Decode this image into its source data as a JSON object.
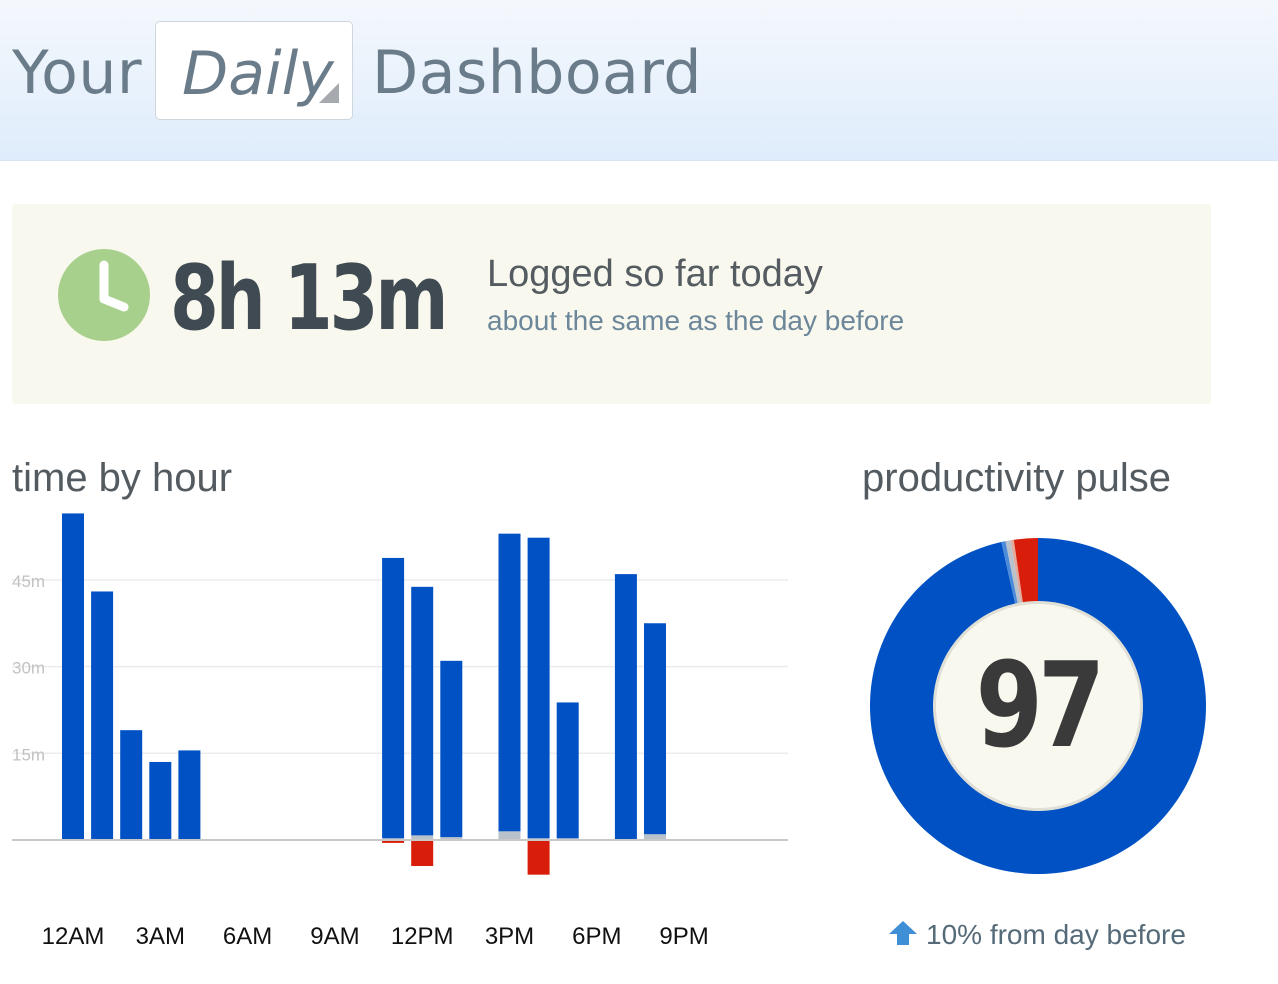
{
  "header": {
    "prefix": "Your",
    "period_selected": "Daily",
    "suffix": "Dashboard"
  },
  "summary": {
    "total_time": "8h 13m",
    "headline": "Logged so far today",
    "comparison": "about the same as the day before",
    "clock_color": "#a8d08d"
  },
  "time_by_hour": {
    "title": "time by hour",
    "chart_data": {
      "type": "bar",
      "title": "time by hour",
      "unit": "minutes",
      "y_ticks": [
        {
          "value": 15,
          "label": "15m"
        },
        {
          "value": 30,
          "label": "30m"
        },
        {
          "value": 45,
          "label": "45m"
        }
      ],
      "ylim": [
        -6,
        57
      ],
      "x_tick_labels": [
        "12AM",
        "3AM",
        "6AM",
        "9AM",
        "12PM",
        "3PM",
        "6PM",
        "9PM"
      ],
      "x_tick_hours": [
        0,
        3,
        6,
        9,
        12,
        15,
        18,
        21
      ],
      "hours": [
        0,
        1,
        2,
        3,
        4,
        5,
        6,
        7,
        8,
        9,
        10,
        11,
        12,
        13,
        14,
        15,
        16,
        17,
        18,
        19,
        20,
        21,
        22,
        23
      ],
      "series": [
        {
          "key": "productive",
          "color": "#0052c4",
          "values": [
            56.5,
            43,
            19,
            13.5,
            15.5,
            0,
            0,
            0,
            0,
            0,
            0,
            48.5,
            43,
            30.5,
            0,
            51.5,
            52,
            23.5,
            0,
            46,
            36.5,
            0,
            0,
            0
          ]
        },
        {
          "key": "neutral",
          "color": "#b9c2cb",
          "values": [
            0,
            0,
            0,
            0,
            0,
            0,
            0,
            0,
            0,
            0,
            0,
            0.3,
            0.8,
            0.5,
            0,
            1.5,
            0.3,
            0.3,
            0,
            0,
            1,
            0,
            0,
            0
          ]
        },
        {
          "key": "distracting",
          "color": "#d81d0a",
          "values": [
            0,
            0,
            0,
            0,
            0,
            0,
            0,
            0,
            0,
            0,
            0,
            0.5,
            4.5,
            0,
            0,
            0,
            6,
            0,
            0,
            0,
            0,
            0,
            0,
            0
          ]
        }
      ],
      "grid": true,
      "legend": "none"
    }
  },
  "productivity_pulse": {
    "title": "productivity pulse",
    "score": "97",
    "change_text": "10% from day before",
    "change_direction": "up",
    "arrow_color": "#3f8fd6",
    "chart_data": {
      "type": "pie",
      "style": "donut",
      "slices": [
        {
          "key": "productive",
          "value": 96.5,
          "color": "#0052c4"
        },
        {
          "key": "productive-light",
          "value": 0.4,
          "color": "#4d8ad8"
        },
        {
          "key": "neutral",
          "value": 0.5,
          "color": "#b9c2cb"
        },
        {
          "key": "slightly-distracting",
          "value": 0.3,
          "color": "#e5a99c"
        },
        {
          "key": "distracting",
          "value": 2.3,
          "color": "#d81d0a"
        }
      ]
    }
  }
}
